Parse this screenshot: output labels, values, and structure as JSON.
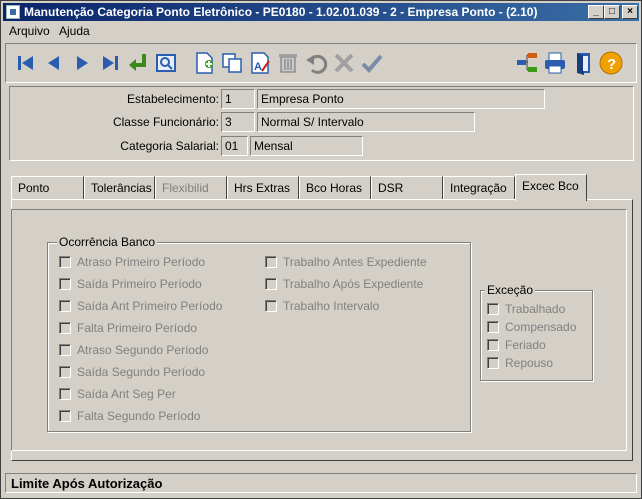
{
  "window": {
    "title": "Manutenção Categoria Ponto Eletrônico - PE0180 - 1.02.01.039 - 2 - Empresa Ponto - (2.10)",
    "minimize": "_",
    "maximize": "□",
    "close": "×"
  },
  "menu": {
    "arquivo": "Arquivo",
    "ajuda": "Ajuda"
  },
  "toolbar": {
    "icons": [
      "first-record-icon",
      "previous-record-icon",
      "next-record-icon",
      "last-record-icon",
      "enter-icon",
      "search-icon",
      "new-document-icon",
      "copy-icon",
      "edit-icon",
      "delete-icon",
      "undo-icon",
      "cancel-icon",
      "confirm-icon",
      "tree-icon",
      "print-icon",
      "exit-icon",
      "help-icon"
    ]
  },
  "header": {
    "estabelecimento": {
      "label": "Estabelecimento:",
      "code": "1",
      "name": "Empresa Ponto"
    },
    "classe": {
      "label": "Classe Funcionário:",
      "code": "3",
      "name": "Normal S/ Intervalo"
    },
    "categoria": {
      "label": "Categoria Salarial:",
      "code": "01",
      "name": "Mensal"
    }
  },
  "tabs": [
    {
      "label": "Ponto"
    },
    {
      "label": "Tolerâncias"
    },
    {
      "label": "Flexibilid"
    },
    {
      "label": "Hrs Extras"
    },
    {
      "label": "Bco Horas"
    },
    {
      "label": "DSR"
    },
    {
      "label": "Integração"
    },
    {
      "label": "Excec Bco"
    }
  ],
  "ocorrencia": {
    "title": "Ocorrência Banco",
    "left": [
      "Atraso Primeiro Período",
      "Saída Primeiro Período",
      "Saída Ant Primeiro Período",
      "Falta Primeiro Período",
      "Atraso Segundo Período",
      "Saída Segundo Período",
      "Saída Ant Seg Per",
      "Falta Segundo Período"
    ],
    "right": [
      "Trabalho Antes Expediente",
      "Trabalho Após Expediente",
      "Trabalho Intervalo"
    ]
  },
  "excecao": {
    "title": "Exceção",
    "items": [
      "Trabalhado",
      "Compensado",
      "Feriado",
      "Repouso"
    ]
  },
  "status": {
    "text": "Limite Após Autorização"
  },
  "colors": {
    "title_start": "#0a246a",
    "title_end": "#3a6ea5",
    "face": "#d4d0c8"
  }
}
